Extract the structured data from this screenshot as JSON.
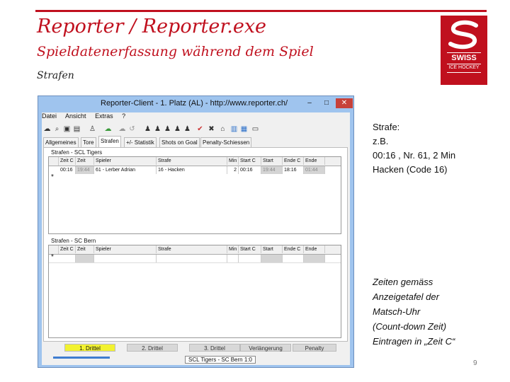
{
  "slide": {
    "title": "Reporter / Reporter.exe",
    "subtitle": "Spieldatenerfassung während dem Spiel",
    "section": "Strafen",
    "page_number": "9",
    "logo_text_main": "SWISS",
    "logo_text_sub": "ICE HOCKEY",
    "accent_color": "#c0101e"
  },
  "window": {
    "title": "Reporter-Client - 1. Platz (AL) - http://www.reporter.ch/",
    "minimize": "–",
    "maximize": "□",
    "close": "✕",
    "menu": [
      "Datei",
      "Ansicht",
      "Extras",
      "?"
    ],
    "toolbar_icons": [
      "cloud-download-icon",
      "search-icon",
      "save-icon",
      "clipboard-icon",
      "person-icon",
      "cloud-upload-icon",
      "cloud-icon",
      "undo-icon",
      "players-icon",
      "players-icon",
      "players-icon",
      "players-icon",
      "players-icon",
      "check-icon",
      "cross-icon",
      "home-icon",
      "chart-icon",
      "stats-icon",
      "tv-icon"
    ],
    "tabs": [
      "Allgemeines",
      "Tore",
      "Strafen",
      "+/- Statistik",
      "Shots on Goal",
      "Penalty-Schiessen"
    ],
    "active_tab": "Strafen"
  },
  "grid_home": {
    "title": "Strafen - SCL Tigers",
    "columns": [
      "Zeit C",
      "Zeit",
      "Spieler",
      "Strafe",
      "Min",
      "Start C",
      "Start",
      "Ende C",
      "Ende"
    ],
    "rows": [
      [
        "00:16",
        "19:44",
        "61 - Lerber Adrian",
        "16 - Hacken",
        "2",
        "00:16",
        "19:44",
        "18:16",
        "01:44"
      ]
    ],
    "new_row_marker": "*"
  },
  "grid_away": {
    "title": "Strafen - SC Bern",
    "columns": [
      "Zeit C",
      "Zeit",
      "Spieler",
      "Strafe",
      "Min",
      "Start C",
      "Start",
      "Ende C",
      "Ende"
    ],
    "new_row_marker": "*"
  },
  "periods": [
    "1. Drittel",
    "2. Drittel",
    "3. Drittel",
    "Verlängerung",
    "Penalty"
  ],
  "active_period": "1. Drittel",
  "status": "SCL Tigers - SC Bern 1:0",
  "annotation": {
    "lines": [
      "Strafe:",
      "z.B.",
      "00:16 , Nr. 61, 2 Min",
      "Hacken (Code 16)"
    ]
  },
  "annotation_italic": {
    "lines": [
      "Zeiten gemäss",
      "Anzeigetafel der",
      "Matsch-Uhr",
      "(Count-down Zeit)",
      "Eintragen in „Zeit C“"
    ]
  }
}
